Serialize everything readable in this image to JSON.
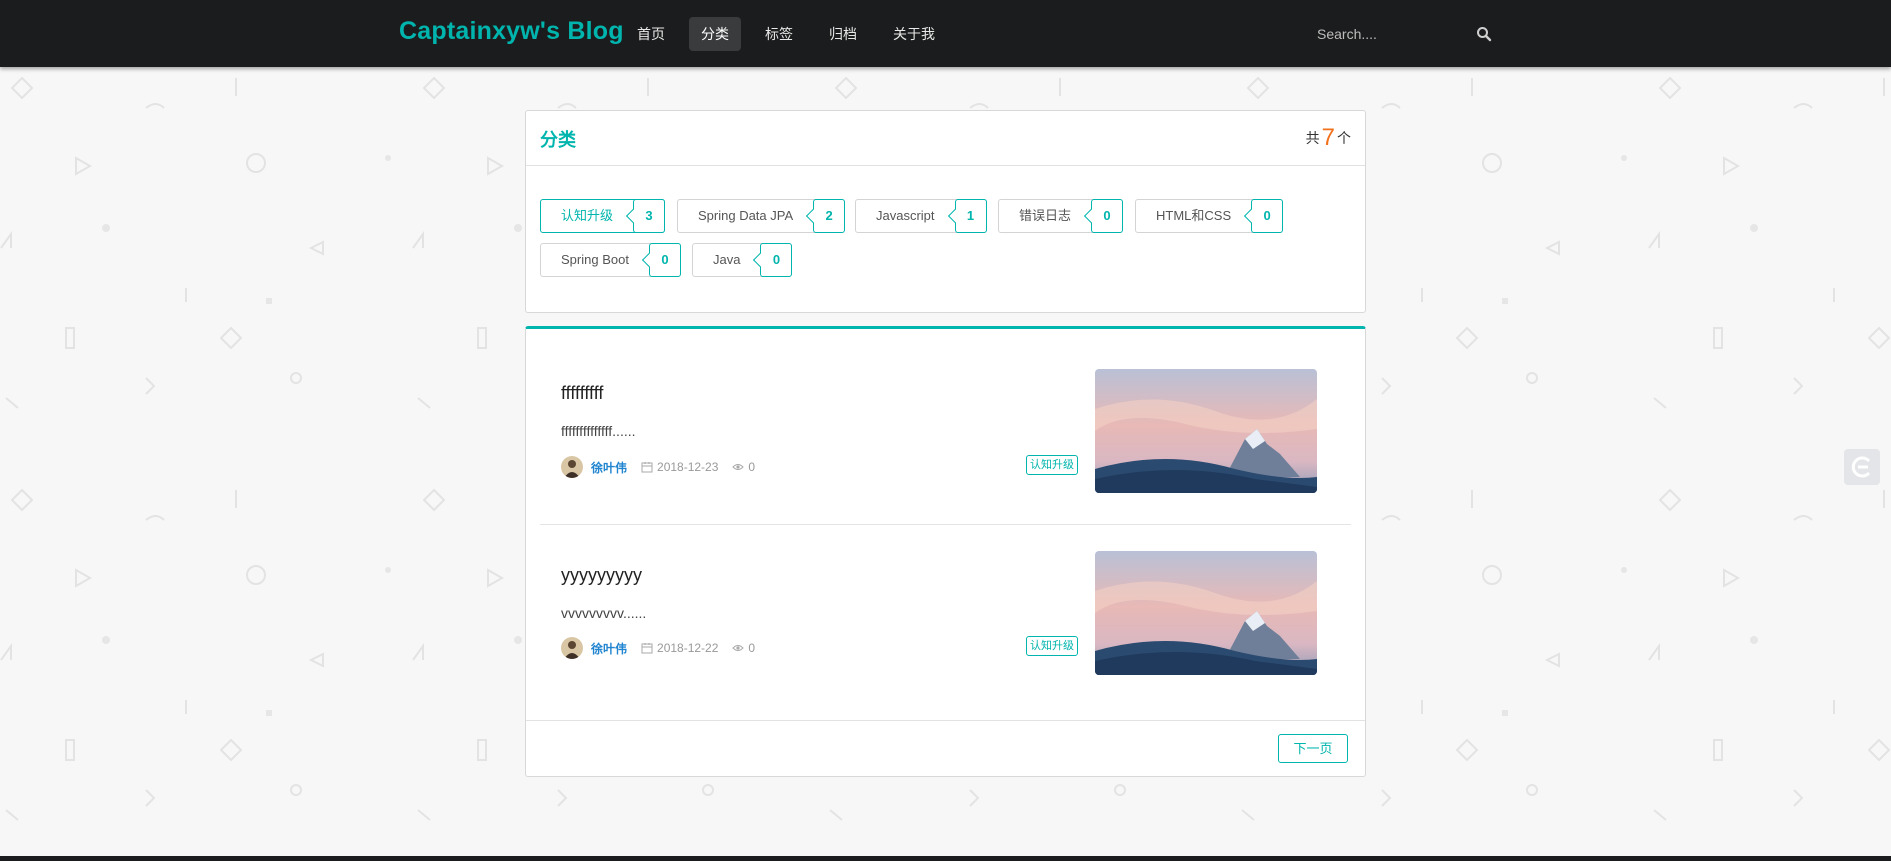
{
  "nav": {
    "brand": "Captainxyw's Blog",
    "items": [
      {
        "label": "首页"
      },
      {
        "label": "分类"
      },
      {
        "label": "标签"
      },
      {
        "label": "归档"
      },
      {
        "label": "关于我"
      }
    ],
    "active_item": "分类",
    "search": {
      "placeholder": "Search....",
      "icon": "search-icon"
    }
  },
  "category_panel": {
    "title": "分类",
    "count_prefix": "共",
    "count": "7",
    "count_suffix": "个",
    "tags": [
      {
        "label": "认知升级",
        "count": "3"
      },
      {
        "label": "Spring Data JPA",
        "count": "2"
      },
      {
        "label": "Javascript",
        "count": "1"
      },
      {
        "label": "错误日志",
        "count": "0"
      },
      {
        "label": "HTML和CSS",
        "count": "0"
      },
      {
        "label": "Spring Boot",
        "count": "0"
      },
      {
        "label": "Java",
        "count": "0"
      }
    ],
    "selected_tag": "认知升级"
  },
  "posts": [
    {
      "title": "fffffffff",
      "excerpt": "ffffffffffffff......",
      "author": "徐叶伟",
      "date": "2018-12-23",
      "views": "0",
      "tag": "认知升级"
    },
    {
      "title": "yyyyyyyyy",
      "excerpt": "vvvvvvvvv......",
      "author": "徐叶伟",
      "date": "2018-12-22",
      "views": "0",
      "tag": "认知升级"
    }
  ],
  "pagination": {
    "next_label": "下一页"
  },
  "colors": {
    "accent": "#00b5ad",
    "navbar": "#1b1c1d",
    "count_highlight": "#f2711c",
    "author": "#2185d0"
  }
}
